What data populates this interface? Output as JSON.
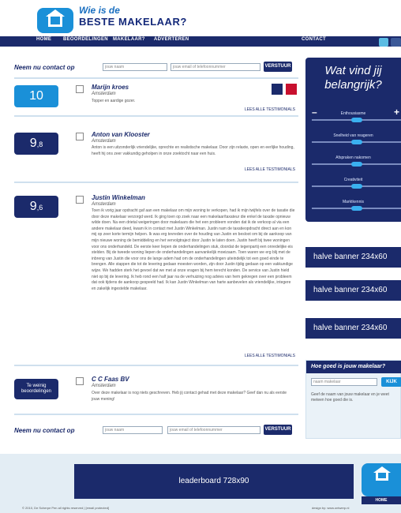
{
  "header": {
    "logo_line1": "Wie is de",
    "logo_line2": "BESTE MAKELAAR?"
  },
  "nav": {
    "home": "HOME",
    "beoordelingen": "BEOORDELINGEN",
    "makelaar": "MAKELAAR?",
    "adverteren": "ADVERTEREN",
    "contact": "CONTACT"
  },
  "contact": {
    "label": "Neem nu contact op",
    "name_placeholder": "jouw naam",
    "email_placeholder": "jouw email of telefoonnummer",
    "button": "VERSTUUR"
  },
  "reviews": [
    {
      "score_int": "10",
      "score_dec": "",
      "name": "Marijn kroes",
      "city": "Amsterdam",
      "text": "Topper en aardige gozer.",
      "link": "LEES ALLE TESTIMONIALS"
    },
    {
      "score_int": "9",
      "score_dec": ",8",
      "name": "Anton van Klooster",
      "city": "Amsterdam",
      "text": "Anton is een uitzonderlijk vriendelijke, oprechte en realistische makelaar. Door zijn relaxte, open en eerlijke houding, heeft hij ons zeer vakkundig geholpen in onze zoektocht naar een huis.",
      "link": "LEES ALLE TESTIMONIALS"
    },
    {
      "score_int": "9",
      "score_dec": ",6",
      "name": "Justin Winkelman",
      "city": "Amsterdam",
      "text": "Toen ik vorig jaar opdracht gaf aan een makelaar om mijn woning te verkopen, had ik mijn twijfels over de taxatie die door deze makelaar verzorgd werd. Ik ging toen op zoek naar een makelaar/taxateur die enkel de taxatie opnieuw wilde doen. Na een drietal weigeringen door makelaars die het een probleem vonden dat ik de verkoop al via een andere makelaar deed, kwam ik in contact met Justin Winkelman. Justin nam de taxatieopdracht direct aan en kon mij op zeer korte termijn helpen. Ik was erg tevreden over de houding van Justin en besloot om bij de aankoop van mijn nieuwe woning de bemiddeling en het vervolgtraject door Justin te laten doen. Justin heeft bij twee woningen voor ons onderhandeld. De eerste keer liepen de onderhandelingen stuk, doordat de tegenpartij een onredelijke eis stelden. Bij de tweede woning liepen de onderhandelingen aanvankelijk moeizaam. Toen waren we erg blij met de inbreng van Justin die voor ons de lange adem had om de onderhandelingen uiteindelijk tot een goed einde te brengen. Alle stappen die tot de levering gedaan moesten worden, zijn door Justin tijdig gedaan op een vakkundige wijze. We hadden sterk het gevoel dat we met al onze vragen bij hem terecht konden. De service van Justin hield niet op bij de levering. Ik heb rond een half jaar na de verhuizing nog advies van hem gekregen over een probleem dat ook tijdens de aankoop gespeeld had. Ik kan Justin Winkelman van harte aanbevelen als vriendelijke, integere en zakelijk ingestelde makelaar.",
      "link": "LEES ALLE TESTIMONIALS"
    },
    {
      "score_int": "Te weinig beoordelingen",
      "score_dec": "",
      "name": "C C Faas BV",
      "city": "Amsterdam",
      "text": "Over deze makelaar is nog niets geschreven. Heb jij contact gehad met deze makelaar? Geef dan nu als eerste jouw mening!",
      "link": ""
    }
  ],
  "vote": {
    "title_line1": "Wat vind jij",
    "title_line2": "belangrijk?",
    "minus": "–",
    "plus": "+",
    "criteria": [
      "Enthousiasme",
      "Snelheid van reageren",
      "Afspraken nakomen",
      "Creativiteit",
      "Marktkennis"
    ]
  },
  "banners": [
    "halve banner 234x60",
    "halve banner 234x60",
    "halve banner 234x60"
  ],
  "hoe": {
    "title": "Hoe goed is jouw makelaar?",
    "placeholder": "naam makelaar",
    "button": "KIJK",
    "text": "Geef de naam van jouw makelaar en je weet meteen hoe goed die is."
  },
  "footer": {
    "leaderboard": "leaderboard 728x90",
    "copyright": "© 2010, De Scherpe Pen all rights reserved | [email protected]",
    "design": "design by: www.ontwerp.nl",
    "home": "HOME"
  },
  "colors": {
    "navy": "#1b2a6b",
    "blue": "#1a90d8",
    "light": "#e3edf4"
  }
}
